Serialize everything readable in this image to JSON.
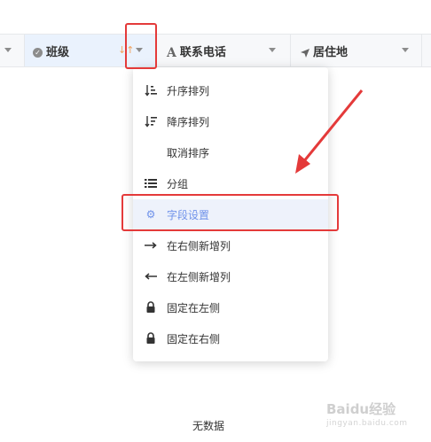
{
  "table": {
    "columns": [
      {
        "key": "class",
        "label": "班级",
        "icon": "check-circle-icon",
        "sort_hint": "↓↑"
      },
      {
        "key": "phone",
        "label": "联系电话",
        "icon": "text-a-icon"
      },
      {
        "key": "address",
        "label": "居住地",
        "icon": "location-arrow-icon"
      }
    ],
    "empty_text": "无数据"
  },
  "menu": {
    "items": [
      {
        "label": "升序排列",
        "icon": "sort-ascending-icon"
      },
      {
        "label": "降序排列",
        "icon": "sort-descending-icon"
      },
      {
        "label": "取消排序",
        "icon": ""
      },
      {
        "label": "分组",
        "icon": "list-icon"
      },
      {
        "label": "字段设置",
        "icon": "gear-icon",
        "active": true
      },
      {
        "label": "在右侧新增列",
        "icon": "arrow-right-icon"
      },
      {
        "label": "在左侧新增列",
        "icon": "arrow-left-icon"
      },
      {
        "label": "固定在左侧",
        "icon": "lock-icon"
      },
      {
        "label": "固定在右侧",
        "icon": "lock-icon"
      }
    ]
  },
  "watermark": {
    "text": "Baidu经验",
    "sub": "jingyan.baidu.com"
  },
  "colors": {
    "accent": "#6f92ea",
    "annotation_red": "#e43a3a",
    "header_bg": "#f7f8fa",
    "selected_col_bg": "#eaf2fd"
  }
}
